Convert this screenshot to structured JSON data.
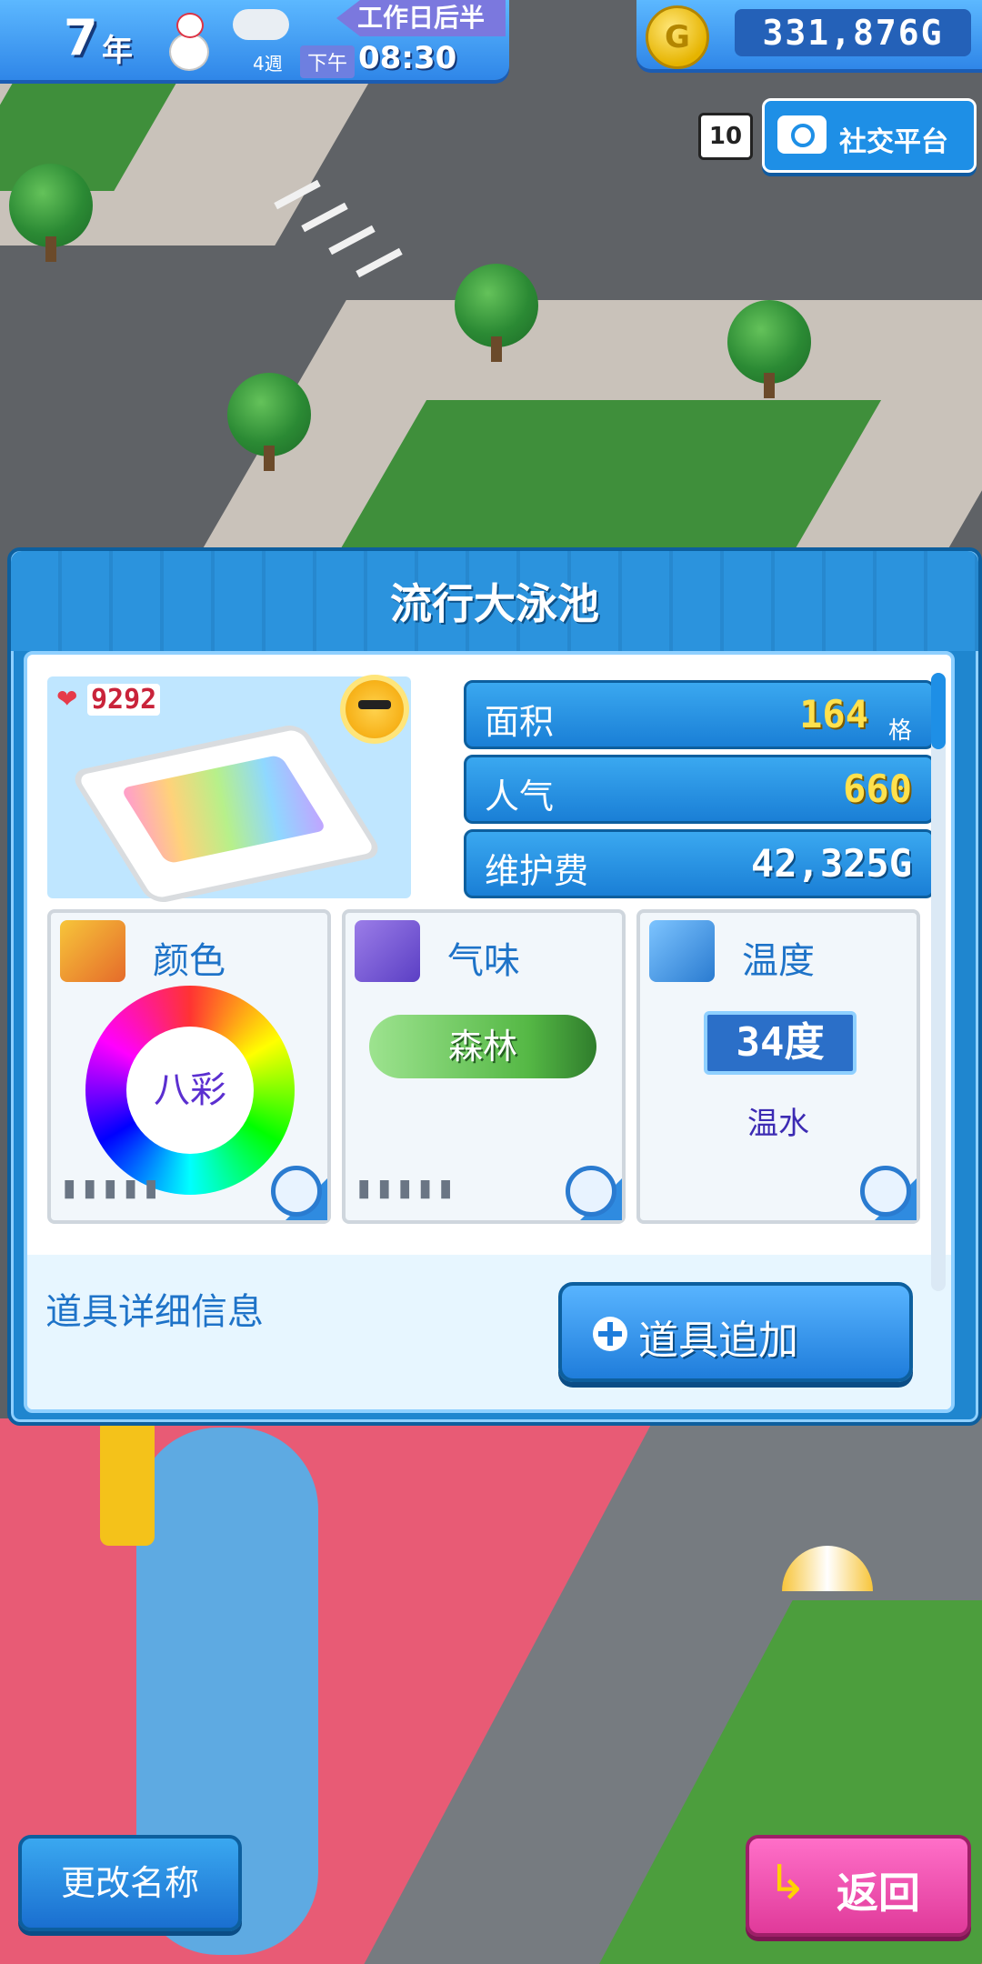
{
  "hud": {
    "year_number": "7",
    "year_unit": "年",
    "week": "4週",
    "period": "下午",
    "time": "08:30",
    "phase": "工作日后半",
    "coin_symbol": "G",
    "gold": "331,876G"
  },
  "social": {
    "badge": "10",
    "label": "社交平台"
  },
  "panel": {
    "title": "流行大泳池",
    "likes": "9292",
    "stats": {
      "area_label": "面积",
      "area_value": "164",
      "area_unit": "格",
      "popularity_label": "人气",
      "popularity_value": "660",
      "maintenance_label": "维护费",
      "maintenance_value": "42,325G"
    },
    "cards": {
      "color_title": "颜色",
      "color_value": "八彩",
      "color_pips": "▮▮▮▮▮",
      "scent_title": "气味",
      "scent_value": "森林",
      "scent_pips": "▮▮▮▮▮",
      "temp_title": "温度",
      "temp_value": "34度",
      "temp_sub": "温水"
    },
    "items_label": "道具详细信息",
    "add_item_label": "道具追加"
  },
  "buttons": {
    "rename": "更改名称",
    "back": "返回"
  },
  "colors": {
    "primary_blue": "#1f86cf",
    "back_pink": "#e03a9a",
    "gold_yellow": "#ffe14d"
  }
}
